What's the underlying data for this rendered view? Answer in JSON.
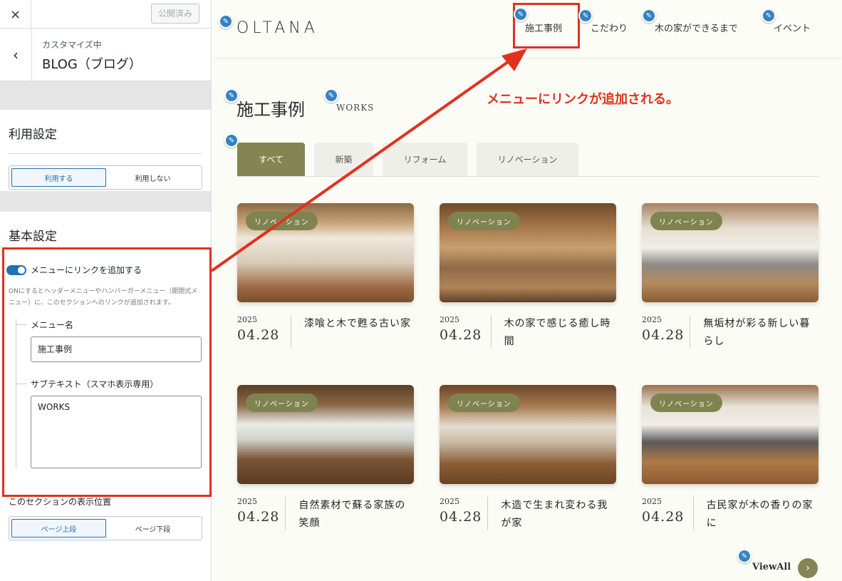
{
  "panel": {
    "close_icon": "×",
    "published": "公開済み",
    "back_icon": "‹",
    "sub": "カスタマイズ中",
    "title": "BLOG（ブログ）",
    "usage": {
      "heading": "利用設定",
      "on": "利用する",
      "off": "利用しない"
    },
    "basic": {
      "heading": "基本設定",
      "toggle_label": "メニューにリンクを追加する",
      "help": "ONにするとヘッダーメニューやハンバーガーメニュー（開閉式メニュー）に、このセクションへのリンクが追加されます。",
      "menu_name_label": "メニュー名",
      "menu_name_value": "施工事例",
      "subtext_label": "サブテキスト（スマホ表示専用）",
      "subtext_value": "WORKS",
      "position_label": "このセクションの表示位置",
      "position_top": "ページ上段",
      "position_bottom": "ページ下段"
    }
  },
  "preview": {
    "logo": "OLTANA",
    "nav": [
      "施工事例",
      "こだわり",
      "木の家ができるまで",
      "イベント"
    ],
    "annotation": "メニューにリンクが追加される。",
    "section_title": "施工事例",
    "section_sub": "WORKS",
    "tabs": [
      "すべて",
      "新築",
      "リフォーム",
      "リノベーション"
    ],
    "cards": [
      {
        "badge": "リノベーション",
        "year": "2025",
        "date": "04.28",
        "title": "漆喰と木で甦る古い家"
      },
      {
        "badge": "リノベーション",
        "year": "2025",
        "date": "04.28",
        "title": "木の家で感じる癒し時間"
      },
      {
        "badge": "リノベーション",
        "year": "2025",
        "date": "04.28",
        "title": "無垢材が彩る新しい暮らし"
      },
      {
        "badge": "リノベーション",
        "year": "2025",
        "date": "04.28",
        "title": "自然素材で蘇る家族の笑顔"
      },
      {
        "badge": "リノベーション",
        "year": "2025",
        "date": "04.28",
        "title": "木造で生まれ変わる我が家"
      },
      {
        "badge": "リノベーション",
        "year": "2025",
        "date": "04.28",
        "title": "古民家が木の香りの家に"
      }
    ],
    "view_all": "ViewAll",
    "view_all_icon": "›",
    "edit_icon": "✎",
    "accent_color": "#838553",
    "annotation_color": "#e0321e"
  }
}
